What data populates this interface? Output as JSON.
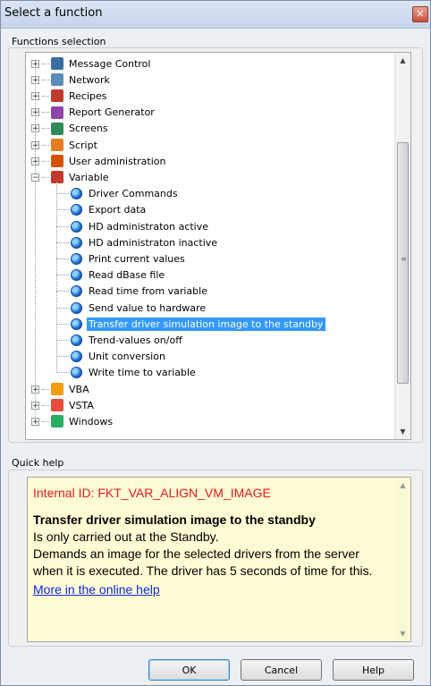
{
  "window": {
    "title": "Select a function"
  },
  "functions_group": {
    "label": "Functions selection",
    "tree": {
      "top_categories": [
        {
          "label": "Message Control",
          "icon": "message-control-icon",
          "color": "#3a6ea5"
        },
        {
          "label": "Network",
          "icon": "network-icon",
          "color": "#5b8db8"
        },
        {
          "label": "Recipes",
          "icon": "recipes-icon",
          "color": "#c0392b"
        },
        {
          "label": "Report Generator",
          "icon": "report-generator-icon",
          "color": "#8e44ad"
        },
        {
          "label": "Screens",
          "icon": "screens-icon",
          "color": "#2e8b57"
        },
        {
          "label": "Script",
          "icon": "script-icon",
          "color": "#e67e22"
        },
        {
          "label": "User administration",
          "icon": "user-admin-icon",
          "color": "#d35400"
        }
      ],
      "variable": {
        "label": "Variable",
        "icon": "variable-icon",
        "color": "#c0392b",
        "children": [
          "Driver Commands",
          "Export data",
          "HD administraton active",
          "HD administraton inactive",
          "Print current values",
          "Read dBase file",
          "Read time from variable",
          "Send value to hardware",
          "Transfer driver simulation image to the standby",
          "Trend-values on/off",
          "Unit conversion",
          "Write time to variable"
        ],
        "selected_index": 8
      },
      "bottom_categories": [
        {
          "label": "VBA",
          "icon": "vba-icon",
          "color": "#f39c12"
        },
        {
          "label": "VSTA",
          "icon": "vsta-icon",
          "color": "#e74c3c"
        },
        {
          "label": "Windows",
          "icon": "windows-icon",
          "color": "#27ae60"
        }
      ]
    }
  },
  "quick_help": {
    "label": "Quick help",
    "internal_id": "Internal ID: FKT_VAR_ALIGN_VM_IMAGE",
    "title": "Transfer driver simulation image to the standby",
    "line1": "Is only carried out at the Standby.",
    "line2": "Demands an image for the selected drivers from the server when it is executed. The driver has 5 seconds of time for this.",
    "link": "More in the online help"
  },
  "buttons": {
    "ok": "OK",
    "cancel": "Cancel",
    "help": "Help"
  }
}
